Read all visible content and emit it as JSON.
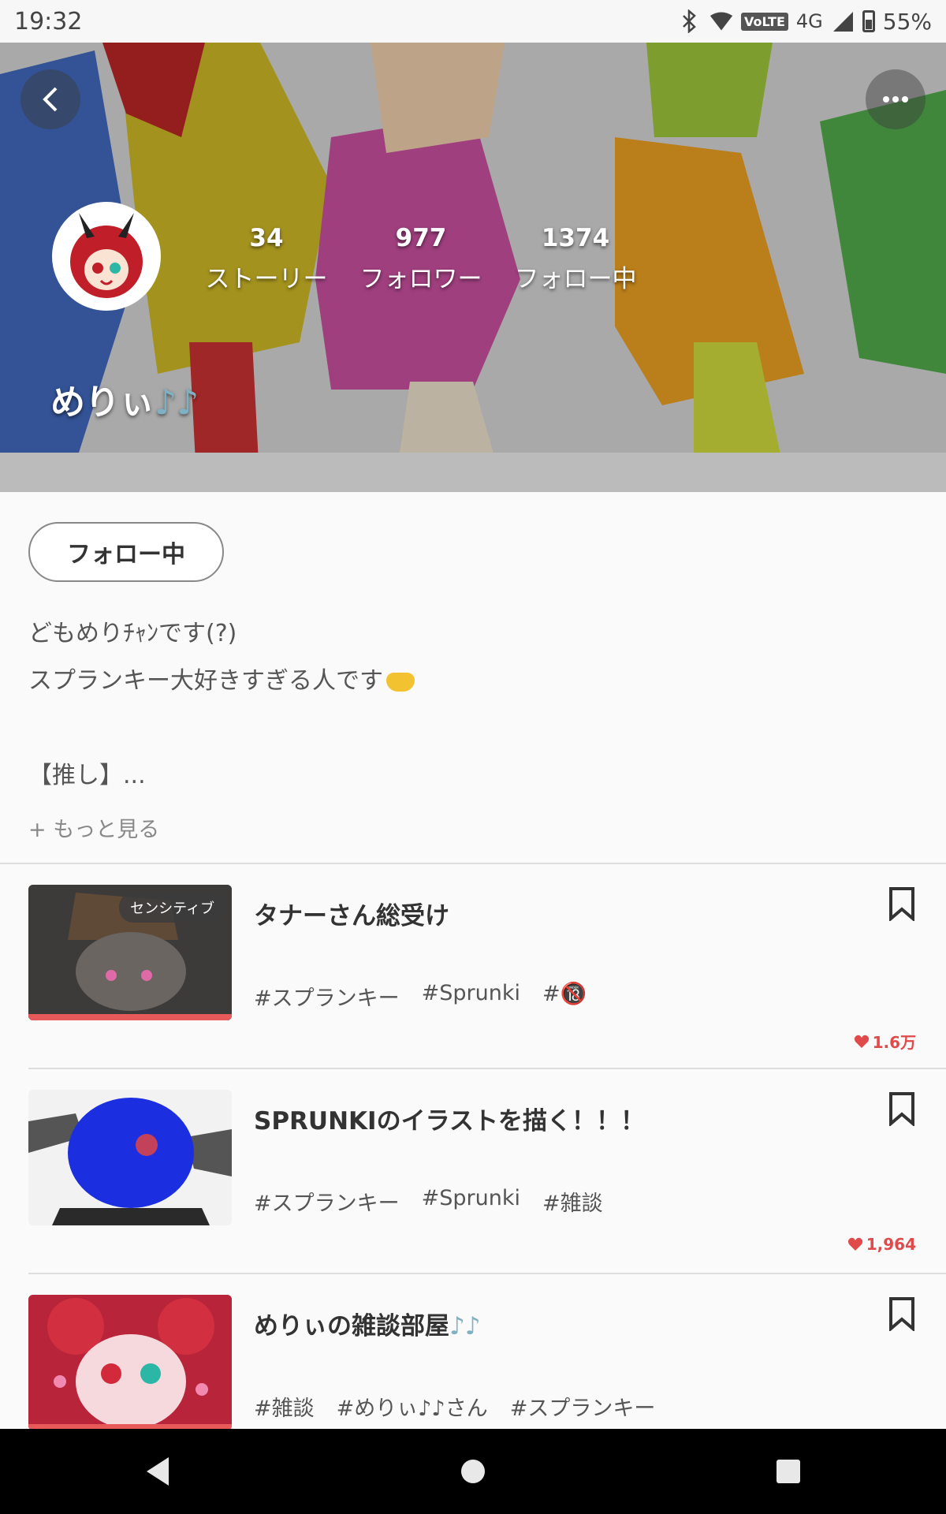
{
  "status": {
    "time": "19:32",
    "volte": "VoLTE",
    "network": "4G",
    "battery": "55%"
  },
  "profile": {
    "username": "めりぃ",
    "username_notes": "♪♪",
    "stats": [
      {
        "num": "34",
        "label": "ストーリー"
      },
      {
        "num": "977",
        "label": "フォロワー"
      },
      {
        "num": "1374",
        "label": "フォロー中"
      }
    ],
    "follow_label": "フォロー中",
    "bio": [
      "どもめりﾁｬﾝです(?)",
      "スプランキー大好きすぎる人です",
      "",
      "【推し】..."
    ],
    "more_label": "+ もっと見る"
  },
  "stories": [
    {
      "title": "タナーさん総受け",
      "title_notes": "",
      "badge": "センシティブ",
      "tags": [
        "#スプランキー",
        "#Sprunki",
        "#🔞"
      ],
      "likes": "1.6万",
      "colors": {
        "bg": "#3a3a3a",
        "accent": "#6d5a4a"
      }
    },
    {
      "title": "SPRUNKIのイラストを描く！！！",
      "title_notes": "",
      "badge": "",
      "tags": [
        "#スプランキー",
        "#Sprunki",
        "#雑談"
      ],
      "likes": "1,964",
      "colors": {
        "bg": "#f4f4f4",
        "accent": "#1b2fe0"
      }
    },
    {
      "title": "めりぃの雑談部屋",
      "title_notes": "♪♪",
      "badge": "",
      "tags": [
        "#雑談",
        "#めりぃ♪♪さん",
        "#スプランキー"
      ],
      "likes": "",
      "colors": {
        "bg": "#c42a3a",
        "accent": "#e86a8a"
      }
    }
  ]
}
